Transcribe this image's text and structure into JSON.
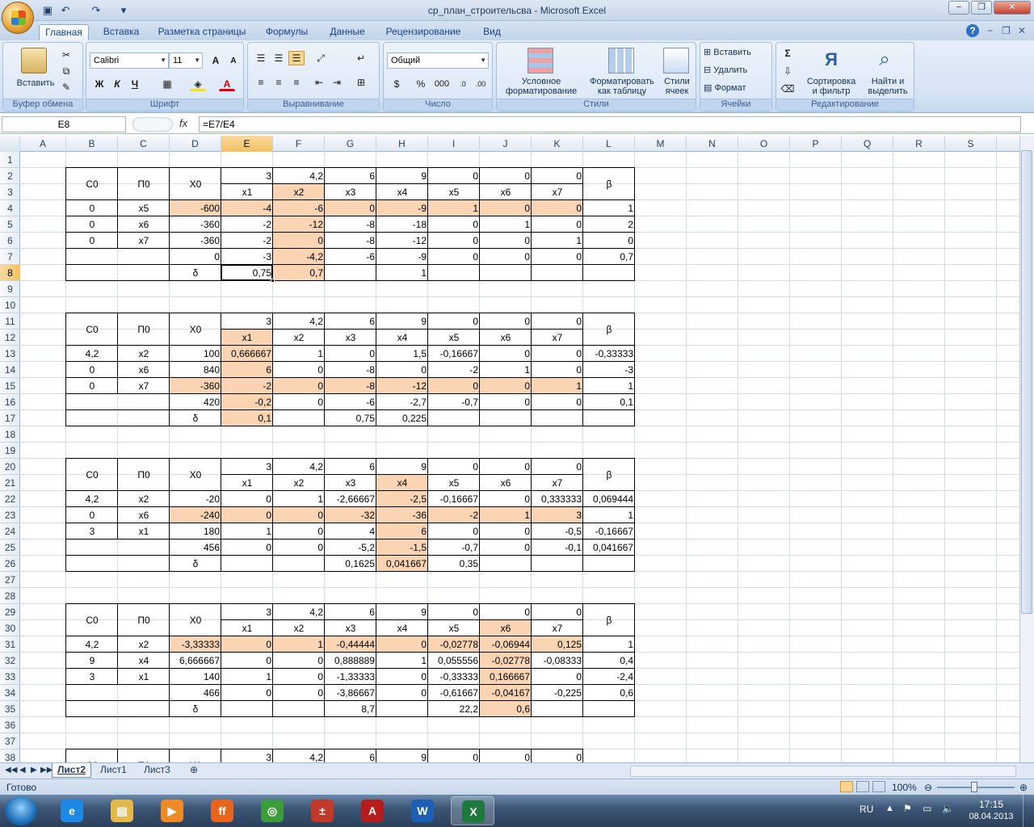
{
  "window": {
    "title": "ср_план_строительсва - Microsoft Excel",
    "minimize": "−",
    "restore": "❐",
    "close": "✕"
  },
  "qat": {
    "save_icon": "save-icon",
    "undo": "↶",
    "redo": "↷",
    "more": "▾"
  },
  "tabs": [
    "Главная",
    "Вставка",
    "Разметка страницы",
    "Формулы",
    "Данные",
    "Рецензирование",
    "Вид"
  ],
  "tab_controls": {
    "help": "?",
    "min": "−",
    "restore": "❐",
    "close": "✕"
  },
  "ribbon": {
    "clipboard": {
      "label": "Буфер обмена",
      "paste": "Вставить"
    },
    "font": {
      "label": "Шрифт",
      "name": "Calibri",
      "size": "11",
      "bold": "Ж",
      "italic": "К",
      "underline": "Ч"
    },
    "alignment": {
      "label": "Выравнивание"
    },
    "number": {
      "label": "Число",
      "format": "Общий",
      "percent": "%",
      "thousands": "000"
    },
    "styles": {
      "label": "Стили",
      "conditional": "Условное\nформатирование",
      "table": "Форматировать\nкак таблицу",
      "cell_styles": "Стили\nячеек"
    },
    "cells": {
      "label": "Ячейки",
      "insert": "Вставить",
      "delete": "Удалить",
      "format": "Формат"
    },
    "editing": {
      "label": "Редактирование",
      "sum": "Σ",
      "sort": "Сортировка\nи фильтр",
      "find": "Найти и\nвыделить"
    }
  },
  "formula_bar": {
    "name_box": "E8",
    "fx": "fx",
    "formula": "=E7/E4"
  },
  "columns": [
    "A",
    "B",
    "C",
    "D",
    "E",
    "F",
    "G",
    "H",
    "I",
    "J",
    "K",
    "L",
    "M",
    "N",
    "O",
    "P",
    "Q",
    "R",
    "S"
  ],
  "rows": [
    "1",
    "2",
    "3",
    "4",
    "5",
    "6",
    "7",
    "8",
    "9",
    "10",
    "11",
    "12",
    "13",
    "14",
    "15",
    "16",
    "17",
    "18",
    "19",
    "20",
    "21",
    "22",
    "23",
    "24",
    "25",
    "26",
    "27",
    "28",
    "29",
    "30",
    "31",
    "32",
    "33",
    "34",
    "35",
    "36",
    "37",
    "38"
  ],
  "selected": {
    "column": "E",
    "row": "8"
  },
  "header_labels": {
    "c0": "С0",
    "p0": "П0",
    "x0": "Х0",
    "beta": "β",
    "delta": "δ"
  },
  "cost_row": [
    "3",
    "4,2",
    "6",
    "9",
    "0",
    "0",
    "0"
  ],
  "var_names": [
    "x1",
    "x2",
    "x3",
    "x4",
    "x5",
    "x6",
    "x7"
  ],
  "tables": [
    {
      "rows": [
        {
          "c": "0",
          "p": "x5",
          "x0": "-600",
          "v": [
            "-4",
            "-6",
            "0",
            "-9",
            "1",
            "0",
            "0"
          ],
          "b": "1"
        },
        {
          "c": "0",
          "p": "x6",
          "x0": "-360",
          "v": [
            "-2",
            "-12",
            "-8",
            "-18",
            "0",
            "1",
            "0"
          ],
          "b": "2"
        },
        {
          "c": "0",
          "p": "x7",
          "x0": "-360",
          "v": [
            "-2",
            "0",
            "-8",
            "-12",
            "0",
            "0",
            "1"
          ],
          "b": "0"
        }
      ],
      "z": {
        "x0": "0",
        "v": [
          "-3",
          "-4,2",
          "-6",
          "-9",
          "0",
          "0",
          "0"
        ],
        "b": "0,7"
      },
      "delta": [
        "0,75",
        "0,7",
        "",
        "1",
        "",
        "",
        ""
      ]
    },
    {
      "rows": [
        {
          "c": "4,2",
          "p": "x2",
          "x0": "100",
          "v": [
            "0,666667",
            "1",
            "0",
            "1,5",
            "-0,16667",
            "0",
            "0"
          ],
          "b": "-0,33333"
        },
        {
          "c": "0",
          "p": "x6",
          "x0": "840",
          "v": [
            "6",
            "0",
            "-8",
            "0",
            "-2",
            "1",
            "0"
          ],
          "b": "-3"
        },
        {
          "c": "0",
          "p": "x7",
          "x0": "-360",
          "v": [
            "-2",
            "0",
            "-8",
            "-12",
            "0",
            "0",
            "1"
          ],
          "b": "1"
        }
      ],
      "z": {
        "x0": "420",
        "v": [
          "-0,2",
          "0",
          "-6",
          "-2,7",
          "-0,7",
          "0",
          "0"
        ],
        "b": "0,1"
      },
      "delta": [
        "0,1",
        "",
        "0,75",
        "0,225",
        "",
        "",
        ""
      ]
    },
    {
      "rows": [
        {
          "c": "4,2",
          "p": "x2",
          "x0": "-20",
          "v": [
            "0",
            "1",
            "-2,66667",
            "-2,5",
            "-0,16667",
            "0",
            "0,333333"
          ],
          "b": "0,069444"
        },
        {
          "c": "0",
          "p": "x6",
          "x0": "-240",
          "v": [
            "0",
            "0",
            "-32",
            "-36",
            "-2",
            "1",
            "3"
          ],
          "b": "1"
        },
        {
          "c": "3",
          "p": "x1",
          "x0": "180",
          "v": [
            "1",
            "0",
            "4",
            "6",
            "0",
            "0",
            "-0,5"
          ],
          "b": "-0,16667"
        }
      ],
      "z": {
        "x0": "456",
        "v": [
          "0",
          "0",
          "-5,2",
          "-1,5",
          "-0,7",
          "0",
          "-0,1"
        ],
        "b": "0,041667"
      },
      "delta": [
        "",
        "",
        "0,1625",
        "0,041667",
        "0,35",
        "",
        ""
      ]
    },
    {
      "rows": [
        {
          "c": "4,2",
          "p": "x2",
          "x0": "-3,33333",
          "v": [
            "0",
            "1",
            "-0,44444",
            "0",
            "-0,02778",
            "-0,06944",
            "0,125"
          ],
          "b": "1"
        },
        {
          "c": "9",
          "p": "x4",
          "x0": "6,666667",
          "v": [
            "0",
            "0",
            "0,888889",
            "1",
            "0,055556",
            "-0,02778",
            "-0,08333"
          ],
          "b": "0,4"
        },
        {
          "c": "3",
          "p": "x1",
          "x0": "140",
          "v": [
            "1",
            "0",
            "-1,33333",
            "0",
            "-0,33333",
            "0,166667",
            "0"
          ],
          "b": "-2,4"
        }
      ],
      "z": {
        "x0": "466",
        "v": [
          "0",
          "0",
          "-3,86667",
          "0",
          "-0,61667",
          "-0,04167",
          "-0,225"
        ],
        "b": "0,6"
      },
      "delta": [
        "",
        "",
        "8,7",
        "",
        "22,2",
        "0,6",
        ""
      ]
    }
  ],
  "sheets": [
    "Лист2",
    "Лист1",
    "Лист3"
  ],
  "status": {
    "ready": "Готово",
    "zoom": "100%"
  },
  "tray": {
    "lang": "RU",
    "time": "17:15",
    "date": "08.04.2013"
  },
  "taskbar_apps": [
    "ie-icon",
    "explorer-icon",
    "media-player-icon",
    "firefox-icon",
    "chrome-icon",
    "calc-app-icon",
    "pdf-icon",
    "word-icon",
    "excel-icon"
  ]
}
